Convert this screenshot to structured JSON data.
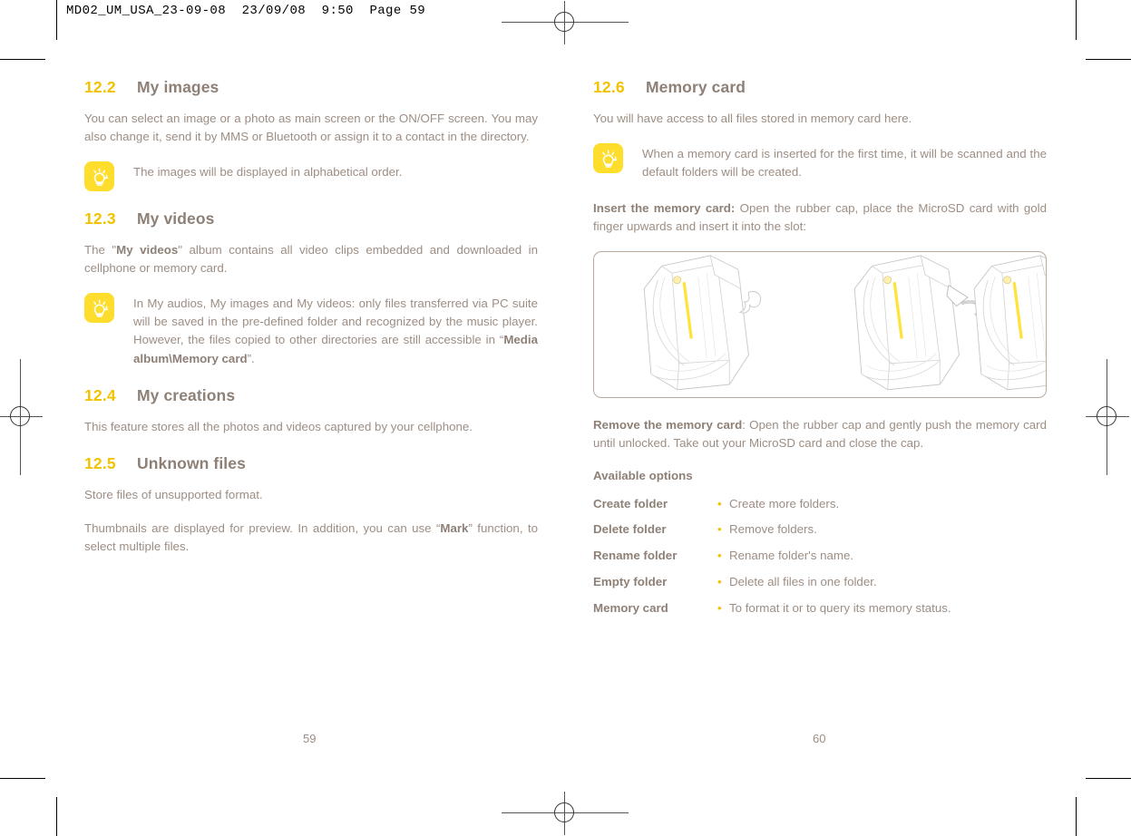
{
  "header": {
    "text": "MD02_UM_USA_23-09-08  23/09/08  9:50  Page 59"
  },
  "colors": {
    "section_number": "#F2C200",
    "heading": "#8E8076",
    "body_text": "#9D8E84",
    "tip_icon_bg": "#FFDD2D",
    "frame_border": "#B9A99C",
    "bullet": "#F2C200"
  },
  "left_page": {
    "folio": "59",
    "sections": [
      {
        "number": "12.2",
        "title": "My images",
        "paragraph": "You can select an image or a photo as main screen or the ON/OFF screen. You may also change it, send it by MMS or Bluetooth or assign it to a contact in the directory.",
        "tip": {
          "icon": "lightbulb-tip-icon",
          "text": "The images will be displayed in alphabetical order."
        }
      },
      {
        "number": "12.3",
        "title": "My videos",
        "paragraph_parts": [
          {
            "text": "The \"",
            "bold": false
          },
          {
            "text": "My videos",
            "bold": true
          },
          {
            "text": "\" album contains all video clips embedded and downloaded in cellphone or memory card.",
            "bold": false
          }
        ],
        "tip": {
          "icon": "lightbulb-tip-icon",
          "parts": [
            {
              "text": "In My audios, My images and My videos: only files transferred via PC suite will be saved in the pre-defined folder and recognized by the music player. However, the files copied to other directories are still accessible in “",
              "bold": false
            },
            {
              "text": "Media album\\Memory card",
              "bold": true
            },
            {
              "text": "”.",
              "bold": false
            }
          ]
        }
      },
      {
        "number": "12.4",
        "title": "My creations",
        "paragraph": "This feature stores all the photos and videos captured by your cellphone."
      },
      {
        "number": "12.5",
        "title": "Unknown files",
        "paragraph": "Store files of unsupported format.",
        "paragraph2_parts": [
          {
            "text": "Thumbnails are displayed for preview. In addition, you can use “",
            "bold": false
          },
          {
            "text": "Mark",
            "bold": true
          },
          {
            "text": "” function, to select multiple files.",
            "bold": false
          }
        ]
      }
    ]
  },
  "right_page": {
    "folio": "60",
    "section": {
      "number": "12.6",
      "title": "Memory card",
      "intro": "You will have access to all files stored in memory card here.",
      "tip": {
        "icon": "lightbulb-tip-icon",
        "text": "When a memory card is inserted for the first time, it will be scanned and the default folders will be created."
      },
      "insert_parts": [
        {
          "text": "Insert the memory card:",
          "bold": true
        },
        {
          "text": " Open the rubber cap, place the MicroSD card with gold finger upwards and insert it into the slot:",
          "bold": false
        }
      ],
      "illustration": {
        "name": "memory-card-insertion-diagram",
        "steps": [
          "flip-phone-with-closed-rubber-cap",
          "flip-phone-with-rubber-cap-opening-arrow",
          "flip-phone-with-microsd-card-inserting-arrow-and-magnified-inset"
        ]
      },
      "remove_parts": [
        {
          "text": "Remove the memory card",
          "bold": true
        },
        {
          "text": ": Open the rubber cap and gently push the memory card until unlocked. Take out your MicroSD card and close the cap.",
          "bold": false
        }
      ],
      "options_heading": "Available options",
      "options": [
        {
          "name": "Create folder",
          "bullet": "•",
          "desc": "Create more folders."
        },
        {
          "name": "Delete folder",
          "bullet": "•",
          "desc": "Remove folders."
        },
        {
          "name": "Rename folder",
          "bullet": "•",
          "desc": "Rename folder's name."
        },
        {
          "name": "Empty folder",
          "bullet": "•",
          "desc": "Delete all files in one folder."
        },
        {
          "name": "Memory card",
          "bullet": "•",
          "desc": "To format it or to query its memory status."
        }
      ]
    }
  }
}
